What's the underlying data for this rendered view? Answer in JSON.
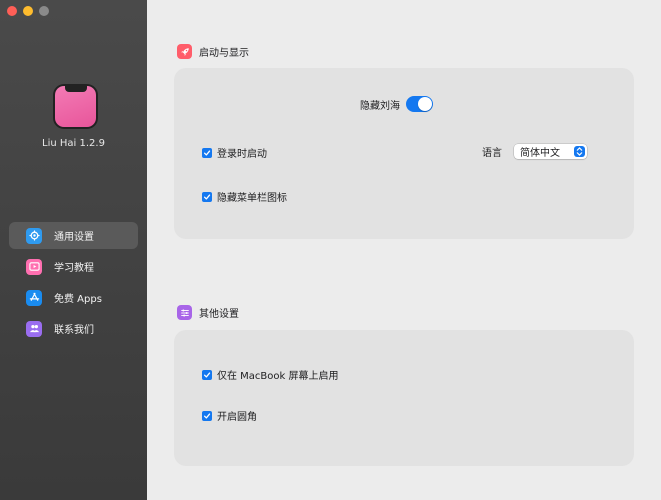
{
  "app": {
    "version_label": "Liu Hai 1.2.9"
  },
  "sidebar": {
    "items": [
      {
        "label": "通用设置",
        "icon": "gear-icon",
        "active": true
      },
      {
        "label": "学习教程",
        "icon": "video-icon",
        "active": false
      },
      {
        "label": "免费 Apps",
        "icon": "app-store-icon",
        "active": false
      },
      {
        "label": "联系我们",
        "icon": "contact-icon",
        "active": false
      }
    ]
  },
  "sections": {
    "startup": {
      "title": "启动与显示",
      "icon": "rocket-icon",
      "hide_notch_label": "隐藏刘海",
      "hide_notch_on": true,
      "launch_at_login_label": "登录时启动",
      "launch_at_login_checked": true,
      "language_label": "语言",
      "language_value": "简体中文",
      "hide_menubar_icon_label": "隐藏菜单栏图标",
      "hide_menubar_icon_checked": true
    },
    "other": {
      "title": "其他设置",
      "icon": "sliders-icon",
      "macbook_only_label": "仅在 MacBook 屏幕上启用",
      "macbook_only_checked": true,
      "rounded_corners_label": "开启圆角",
      "rounded_corners_checked": true
    }
  },
  "colors": {
    "accent": "#1478f0",
    "sidebar_bg": "#414141",
    "main_bg": "#ececec",
    "card_bg": "#e2e2e2"
  }
}
